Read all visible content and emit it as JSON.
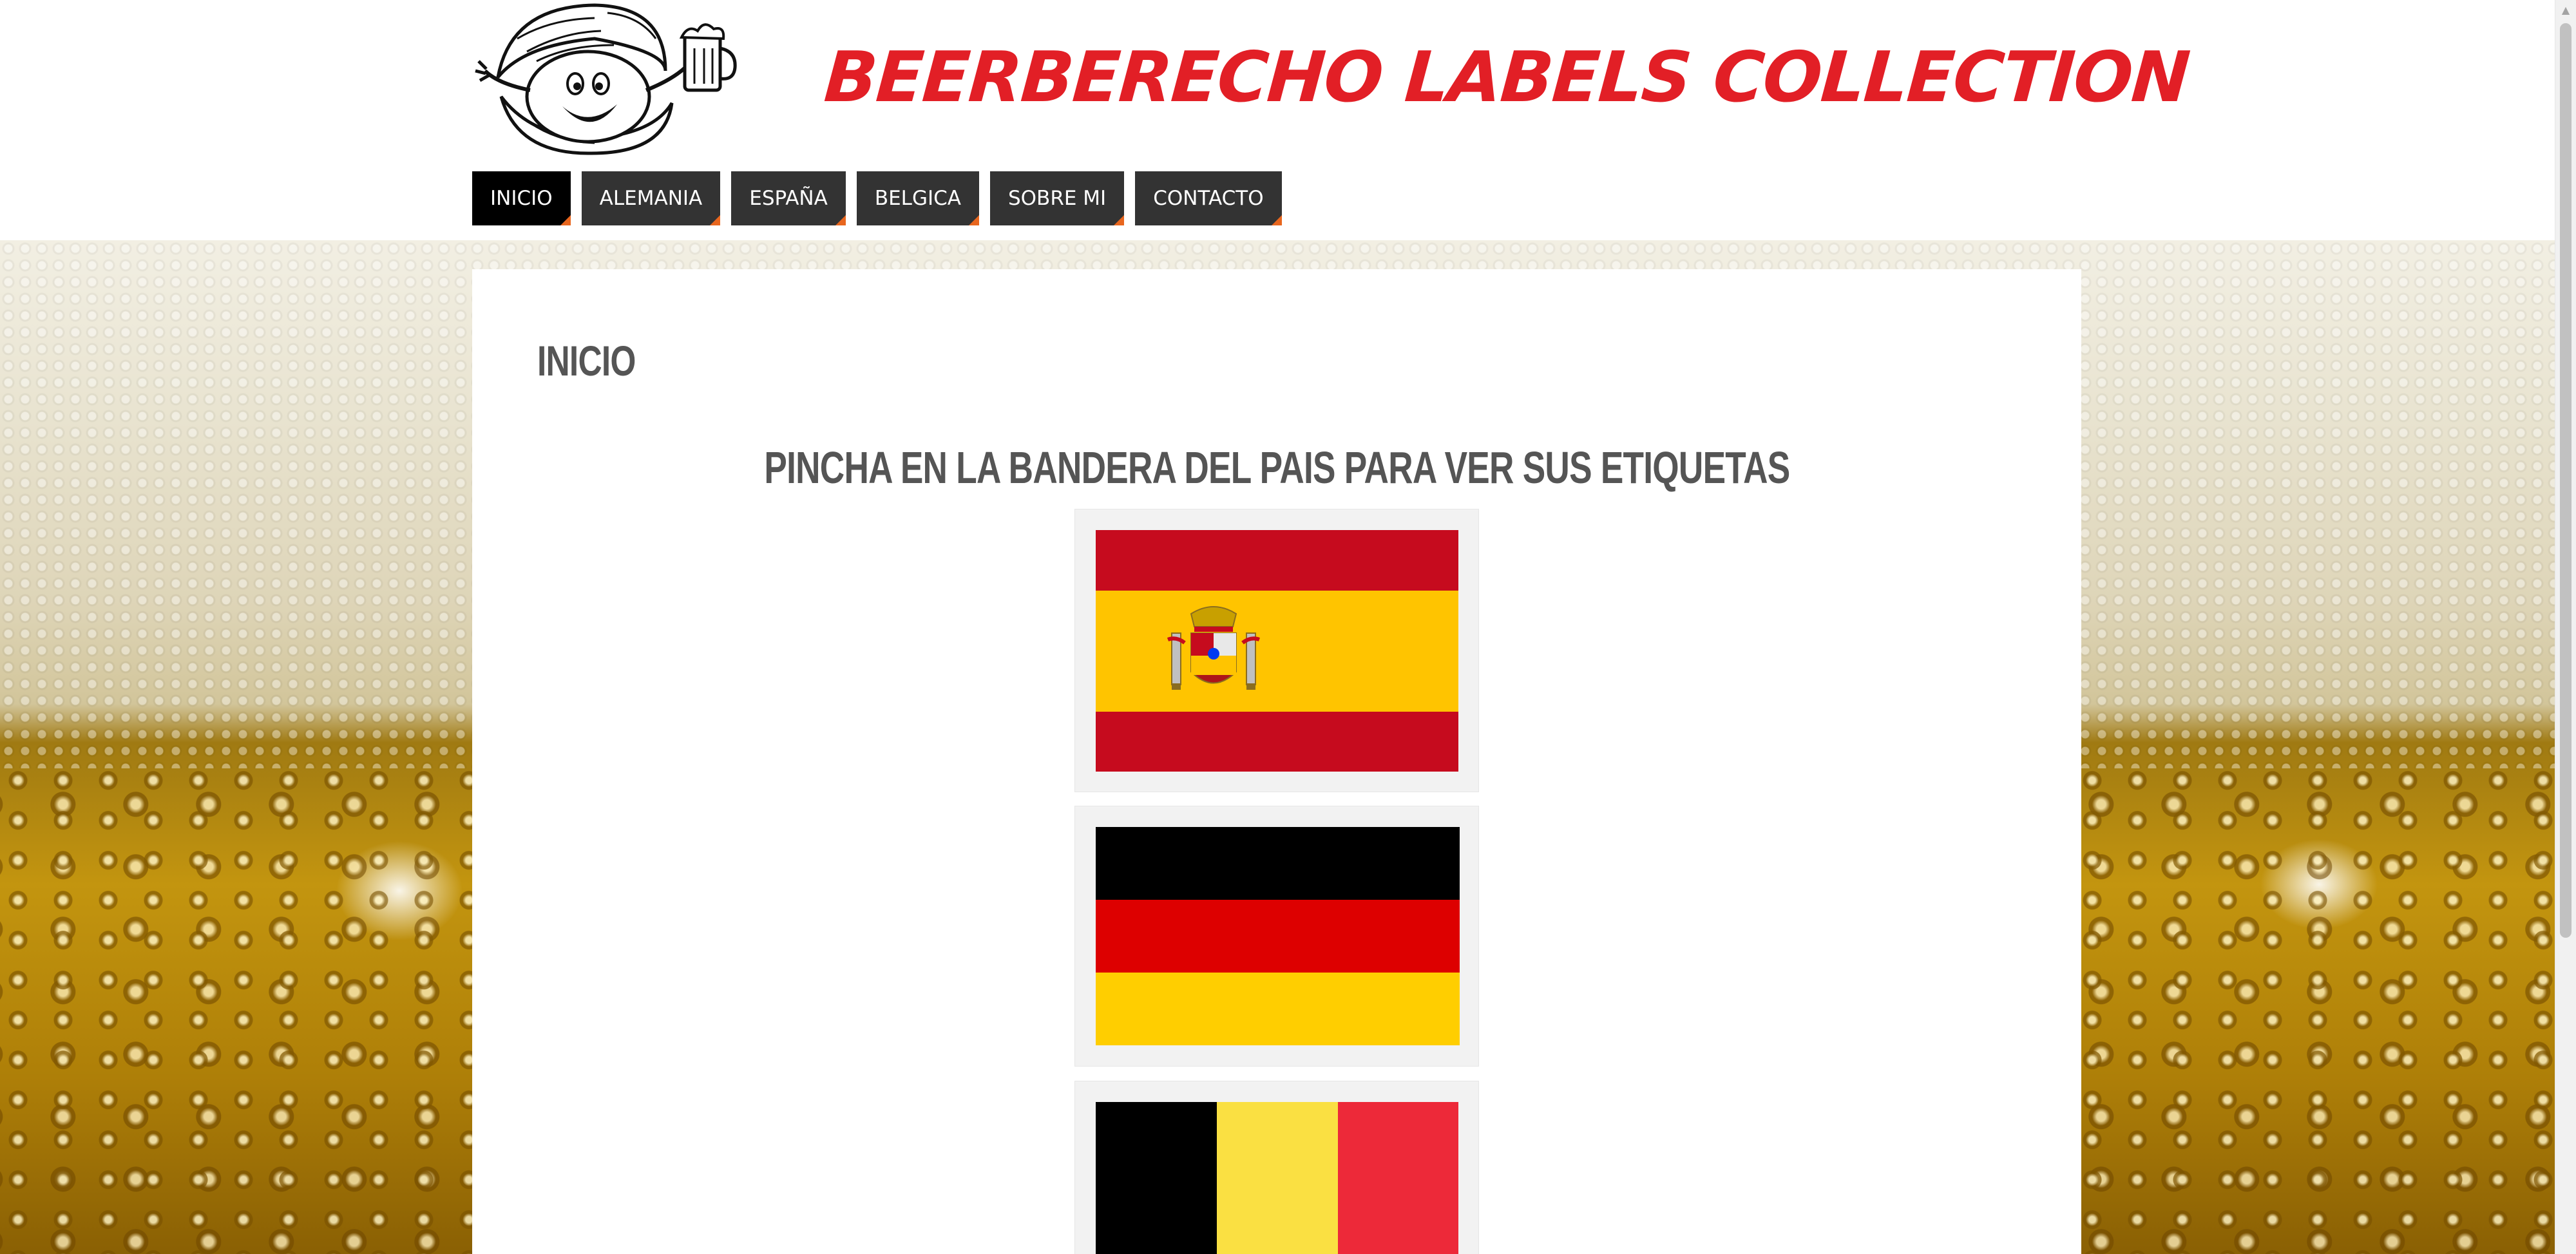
{
  "site": {
    "title": "BEERBERECHO LABELS COLLECTION"
  },
  "nav": [
    {
      "label": "INICIO",
      "active": true
    },
    {
      "label": "ALEMANIA",
      "active": false
    },
    {
      "label": "ESPAÑA",
      "active": false
    },
    {
      "label": "BELGICA",
      "active": false
    },
    {
      "label": "SOBRE MI",
      "active": false
    },
    {
      "label": "CONTACTO",
      "active": false
    }
  ],
  "page": {
    "title": "INICIO",
    "instruction": "PINCHA EN LA BANDERA DEL PAIS PARA VER SUS ETIQUETAS"
  },
  "flags": [
    {
      "country": "spain-flag",
      "colors": [
        "#c60b1e",
        "#ffc400",
        "#c60b1e"
      ]
    },
    {
      "country": "germany-flag",
      "colors": [
        "#000000",
        "#dd0000",
        "#ffce00"
      ]
    },
    {
      "country": "belgium-flag",
      "colors": [
        "#000000",
        "#fae042",
        "#ed2939"
      ]
    }
  ],
  "colors": {
    "title_red": "#e21f26",
    "nav_bg": "#333333",
    "nav_active_bg": "#000000",
    "nav_accent": "#e8661e",
    "heading_grey": "#555555"
  }
}
